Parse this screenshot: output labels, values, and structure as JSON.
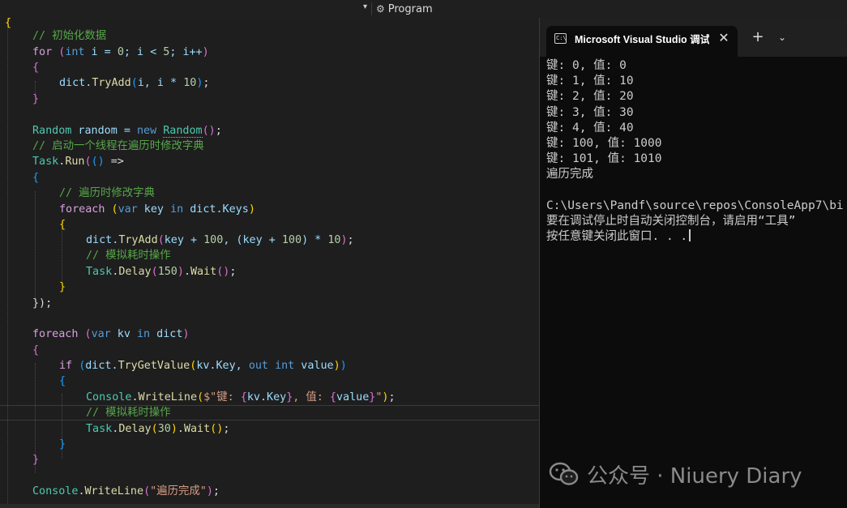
{
  "nav": {
    "member_label": "Program"
  },
  "code": {
    "l1": "// 初始化数据",
    "l2_for": "for",
    "l2_int": "int",
    "l2_rest_a": " i = ",
    "l2_0": "0",
    "l2_rest_b": "; i < ",
    "l2_5": "5",
    "l2_rest_c": "; i++",
    "l4_a": "dict.",
    "l4_m": "TryAdd",
    "l4_b": "i, i * ",
    "l4_10": "10",
    "l7_type": "Random",
    "l7_var": " random = ",
    "l7_new": "new",
    "l7_ctor": "Random",
    "l8": "// 启动一个线程在遍历时修改字典",
    "l9_type": "Task",
    "l9_m": "Run",
    "l9_arrow": " =>",
    "l11": "// 遍历时修改字典",
    "l12_foreach": "foreach",
    "l12_var": "var",
    "l12_key": " key ",
    "l12_in": "in",
    "l12_rest": " dict.Keys",
    "l14_a": "dict.",
    "l14_m": "TryAdd",
    "l14_b": "key + ",
    "l14_100": "100",
    "l14_c": ", (key + ",
    "l14_100b": "100",
    "l14_d": ") * ",
    "l14_10": "10",
    "l15": "// 模拟耗时操作",
    "l16_type": "Task",
    "l16_m": "Delay",
    "l16_150": "150",
    "l16_w": "Wait",
    "l18_end": "});",
    "l20_foreach": "foreach",
    "l20_var": "var",
    "l20_kv": " kv ",
    "l20_in": "in",
    "l20_rest": " dict",
    "l22_if": "if",
    "l22_a": "dict.",
    "l22_m": "TryGetValue",
    "l22_b": "kv.Key, ",
    "l22_out": "out",
    "l22_int": "int",
    "l22_c": " value",
    "l24_type": "Console",
    "l24_m": "WriteLine",
    "l24_s1": "$\"键: ",
    "l24_i1": "kv.Key",
    "l24_s2": ", 值: ",
    "l24_i2": "value",
    "l24_s3": "\"",
    "l25": "// 模拟耗时操作",
    "l26_type": "Task",
    "l26_m": "Delay",
    "l26_30": "30",
    "l26_w": "Wait",
    "l29_type": "Console",
    "l29_m": "WriteLine",
    "l29_s": "\"遍历完成\""
  },
  "console": {
    "tab_title": "Microsoft Visual Studio 调试控制台",
    "lines": [
      "键: 0, 值: 0",
      "键: 1, 值: 10",
      "键: 2, 值: 20",
      "键: 3, 值: 30",
      "键: 4, 值: 40",
      "键: 100, 值: 1000",
      "键: 101, 值: 1010",
      "遍历完成",
      "",
      "C:\\Users\\Pandf\\source\\repos\\ConsoleApp7\\bi",
      "要在调试停止时自动关闭控制台，请启用“工具”",
      "按任意键关闭此窗口. . ."
    ]
  },
  "watermark": {
    "text": "公众号 · Niuery Diary"
  }
}
